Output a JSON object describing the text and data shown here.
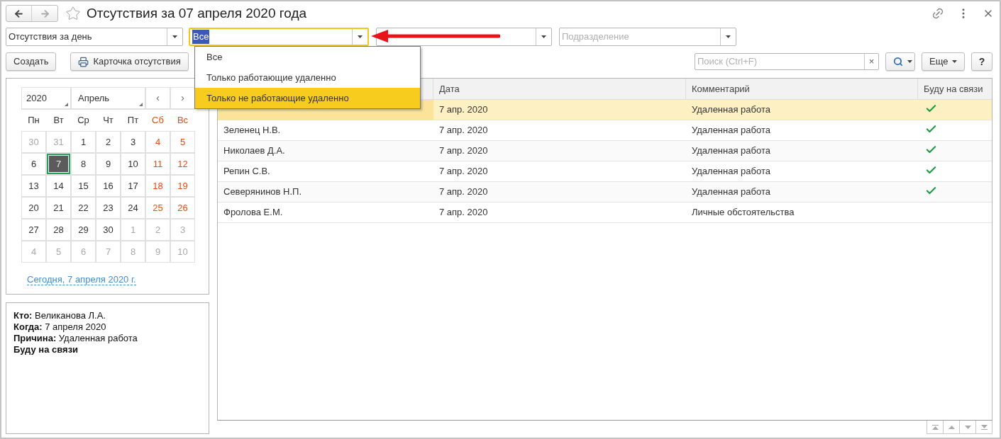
{
  "window": {
    "title": "Отсутствия за 07 апреля 2020 года"
  },
  "filters": [
    {
      "kind": "select",
      "value": "Отсутствия за день",
      "focused": false
    },
    {
      "kind": "select",
      "value": "Все",
      "focused": true
    },
    {
      "kind": "select",
      "focused": false
    },
    {
      "kind": "select",
      "placeholder": "Подразделение",
      "focused": false
    }
  ],
  "dropdown": {
    "options": [
      {
        "label": "Все",
        "selected": false
      },
      {
        "label": "Только работающие удаленно",
        "selected": false
      },
      {
        "label": "Только не работающие удаленно",
        "selected": true
      }
    ]
  },
  "toolbar": {
    "create": "Создать",
    "card": "Карточка отсутствия",
    "search": {
      "placeholder": "Поиск (Ctrl+F)",
      "clear": "×"
    },
    "more": "Еще",
    "help": "?"
  },
  "calendar": {
    "year": "2020",
    "month": "Апрель",
    "prev": "‹",
    "next": "›",
    "weekdays": [
      {
        "label": "Пн",
        "weekend": false
      },
      {
        "label": "Вт",
        "weekend": false
      },
      {
        "label": "Ср",
        "weekend": false
      },
      {
        "label": "Чт",
        "weekend": false
      },
      {
        "label": "Пт",
        "weekend": false
      },
      {
        "label": "Сб",
        "weekend": true
      },
      {
        "label": "Вс",
        "weekend": true
      }
    ],
    "weeks": [
      [
        {
          "day": "30",
          "other_month": true,
          "selected": false
        },
        {
          "day": "31",
          "other_month": true,
          "selected": false
        },
        {
          "day": "1",
          "other_month": false,
          "weekend": false,
          "selected": false
        },
        {
          "day": "2",
          "other_month": false,
          "weekend": false,
          "selected": false
        },
        {
          "day": "3",
          "other_month": false,
          "weekend": false,
          "selected": false
        },
        {
          "day": "4",
          "other_month": false,
          "weekend": true,
          "selected": false
        },
        {
          "day": "5",
          "other_month": false,
          "weekend": true,
          "selected": false
        }
      ],
      [
        {
          "day": "6",
          "other_month": false,
          "weekend": false,
          "selected": false
        },
        {
          "day": "7",
          "other_month": false,
          "weekend": false,
          "selected": true
        },
        {
          "day": "8",
          "other_month": false,
          "weekend": false,
          "selected": false
        },
        {
          "day": "9",
          "other_month": false,
          "weekend": false,
          "selected": false
        },
        {
          "day": "10",
          "other_month": false,
          "weekend": false,
          "selected": false
        },
        {
          "day": "11",
          "other_month": false,
          "weekend": true,
          "selected": false
        },
        {
          "day": "12",
          "other_month": false,
          "weekend": true,
          "selected": false
        }
      ],
      [
        {
          "day": "13",
          "other_month": false,
          "weekend": false,
          "selected": false
        },
        {
          "day": "14",
          "other_month": false,
          "weekend": false,
          "selected": false
        },
        {
          "day": "15",
          "other_month": false,
          "weekend": false,
          "selected": false
        },
        {
          "day": "16",
          "other_month": false,
          "weekend": false,
          "selected": false
        },
        {
          "day": "17",
          "other_month": false,
          "weekend": false,
          "selected": false
        },
        {
          "day": "18",
          "other_month": false,
          "weekend": true,
          "selected": false
        },
        {
          "day": "19",
          "other_month": false,
          "weekend": true,
          "selected": false
        }
      ],
      [
        {
          "day": "20",
          "other_month": false,
          "weekend": false,
          "selected": false
        },
        {
          "day": "21",
          "other_month": false,
          "weekend": false,
          "selected": false
        },
        {
          "day": "22",
          "other_month": false,
          "weekend": false,
          "selected": false
        },
        {
          "day": "23",
          "other_month": false,
          "weekend": false,
          "selected": false
        },
        {
          "day": "24",
          "other_month": false,
          "weekend": false,
          "selected": false
        },
        {
          "day": "25",
          "other_month": false,
          "weekend": true,
          "selected": false
        },
        {
          "day": "26",
          "other_month": false,
          "weekend": true,
          "selected": false
        }
      ],
      [
        {
          "day": "27",
          "other_month": false,
          "weekend": false,
          "selected": false
        },
        {
          "day": "28",
          "other_month": false,
          "weekend": false,
          "selected": false
        },
        {
          "day": "29",
          "other_month": false,
          "weekend": false,
          "selected": false
        },
        {
          "day": "30",
          "other_month": false,
          "weekend": false,
          "selected": false
        },
        {
          "day": "1",
          "other_month": true,
          "selected": false
        },
        {
          "day": "2",
          "other_month": true,
          "selected": false
        },
        {
          "day": "3",
          "other_month": true,
          "selected": false
        }
      ],
      [
        {
          "day": "4",
          "other_month": true,
          "selected": false
        },
        {
          "day": "5",
          "other_month": true,
          "selected": false
        },
        {
          "day": "6",
          "other_month": true,
          "selected": false
        },
        {
          "day": "7",
          "other_month": true,
          "selected": false
        },
        {
          "day": "8",
          "other_month": true,
          "selected": false
        },
        {
          "day": "9",
          "other_month": true,
          "selected": false
        },
        {
          "day": "10",
          "other_month": true,
          "selected": false
        }
      ]
    ],
    "today_link": "Сегодня, 7 апреля 2020 г."
  },
  "details": [
    {
      "text": "**Кто:** Великанова Л.А.",
      "bold": false
    },
    {
      "text": "**Когда:** 7 апреля 2020",
      "bold": false
    },
    {
      "text": "**Причина:** Удаленная работа",
      "bold": false
    },
    {
      "text": "Буду на связи",
      "bold": true
    }
  ],
  "table": {
    "columns": [
      "Дата",
      "Комментарий",
      "Буду на связи"
    ],
    "rows": [
      {
        "date": "7 апр. 2020",
        "comment": "Удаленная работа",
        "in_touch": true,
        "selected": true
      },
      {
        "name": "Зеленец Н.В.",
        "date": "7 апр. 2020",
        "comment": "Удаленная работа",
        "in_touch": true,
        "selected": false
      },
      {
        "name": "Николаев Д.А.",
        "date": "7 апр. 2020",
        "comment": "Удаленная работа",
        "in_touch": true,
        "selected": false
      },
      {
        "name": "Репин С.В.",
        "date": "7 апр. 2020",
        "comment": "Удаленная работа",
        "in_touch": true,
        "selected": false
      },
      {
        "name": "Северянинов Н.П.",
        "date": "7 апр. 2020",
        "comment": "Удаленная работа",
        "in_touch": true,
        "selected": false
      },
      {
        "name": "Фролова Е.М.",
        "date": "7 апр. 2020",
        "comment": "Личные обстоятельства",
        "in_touch": false,
        "selected": false
      }
    ]
  }
}
